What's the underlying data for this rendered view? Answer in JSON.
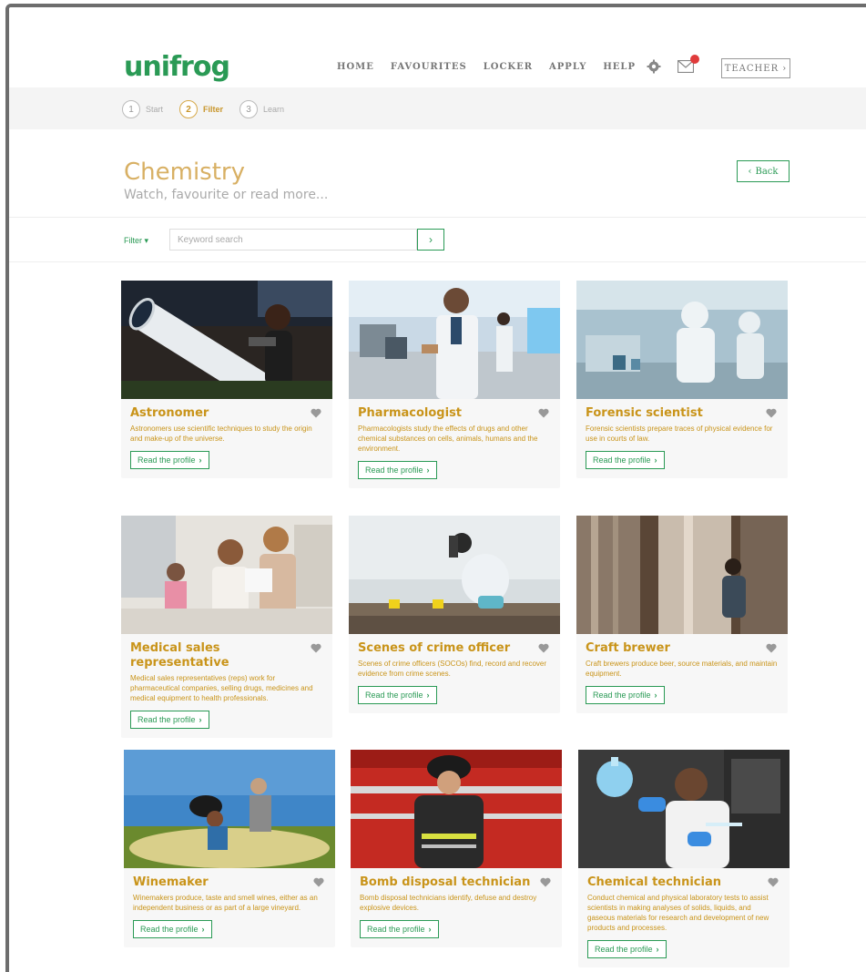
{
  "header": {
    "logo": "unifrog",
    "nav": [
      "HOME",
      "FAVOURITES",
      "LOCKER",
      "APPLY",
      "HELP"
    ],
    "teacher_label": "TEACHER ›"
  },
  "steps": [
    {
      "num": "1",
      "label": "Start"
    },
    {
      "num": "2",
      "label": "Filter"
    },
    {
      "num": "3",
      "label": "Learn"
    }
  ],
  "page": {
    "title": "Chemistry",
    "subtitle": "Watch, favourite or read more...",
    "back_label": "Back"
  },
  "filter": {
    "label": "Filter ▾",
    "placeholder": "Keyword search",
    "go_label": "›"
  },
  "cards": [
    {
      "title": "Astronomer",
      "desc": "Astronomers use scientific techniques to study the origin and make-up of the universe.",
      "button": "Read the profile"
    },
    {
      "title": "Pharmacologist",
      "desc": "Pharmacologists study the effects of drugs and other chemical substances on cells, animals, humans and the environment.",
      "button": "Read the profile"
    },
    {
      "title": "Forensic scientist",
      "desc": "Forensic scientists prepare traces of physical evidence for use in courts of law.",
      "button": "Read the profile"
    },
    {
      "title": "Medical sales representative",
      "desc": "Medical sales representatives (reps) work for pharmaceutical companies, selling drugs, medicines and medical equipment to health professionals.",
      "button": "Read the profile"
    },
    {
      "title": "Scenes of crime officer",
      "desc": "Scenes of crime officers (SOCOs) find, record and recover evidence from crime scenes.",
      "button": "Read the profile"
    },
    {
      "title": "Craft brewer",
      "desc": "Craft brewers produce beer, source materials, and maintain equipment.",
      "button": "Read the profile"
    },
    {
      "title": "Winemaker",
      "desc": "Winemakers produce, taste and smell wines, either as an independent business or as part of a large vineyard.",
      "button": "Read the profile"
    },
    {
      "title": "Bomb disposal technician",
      "desc": "Bomb disposal technicians identify, defuse and destroy explosive devices.",
      "button": "Read the profile"
    },
    {
      "title": "Chemical technician",
      "desc": "Conduct chemical and physical laboratory tests to assist scientists in making analyses of solids, liquids, and gaseous materials for research and development of new products and processes.",
      "button": "Read the profile"
    }
  ]
}
